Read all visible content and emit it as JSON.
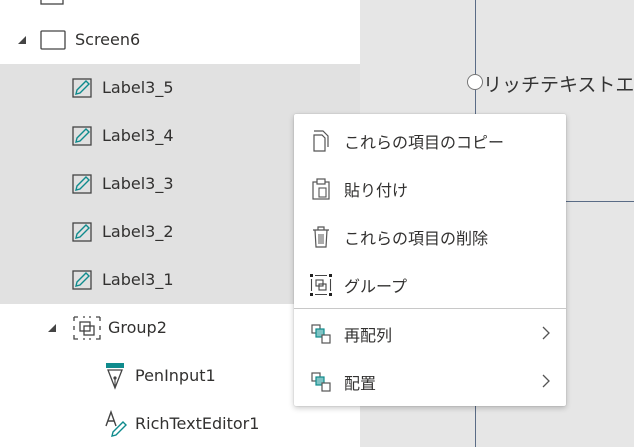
{
  "tree": {
    "screen": {
      "label": "Screen6"
    },
    "labels": [
      {
        "label": "Label3_5"
      },
      {
        "label": "Label3_4"
      },
      {
        "label": "Label3_3"
      },
      {
        "label": "Label3_2"
      },
      {
        "label": "Label3_1"
      }
    ],
    "group": {
      "label": "Group2"
    },
    "children": [
      {
        "label": "PenInput1"
      },
      {
        "label": "RichTextEditor1"
      }
    ]
  },
  "canvas": {
    "rich_text_preview": "リッチテキストエ"
  },
  "menu": {
    "items": [
      {
        "label": "これらの項目のコピー",
        "icon": "copy-icon"
      },
      {
        "label": "貼り付け",
        "icon": "paste-icon"
      },
      {
        "label": "これらの項目の削除",
        "icon": "delete-icon"
      },
      {
        "label": "グループ",
        "icon": "group-icon"
      },
      {
        "label": "再配列",
        "icon": "reorder-icon",
        "submenu": true
      },
      {
        "label": "配置",
        "icon": "align-icon",
        "submenu": true
      }
    ]
  },
  "colors": {
    "selected_row": "#e1e1e1",
    "canvas_bg": "#e6e6e6",
    "accent_teal": "#0f8b8d",
    "text": "#323130"
  }
}
